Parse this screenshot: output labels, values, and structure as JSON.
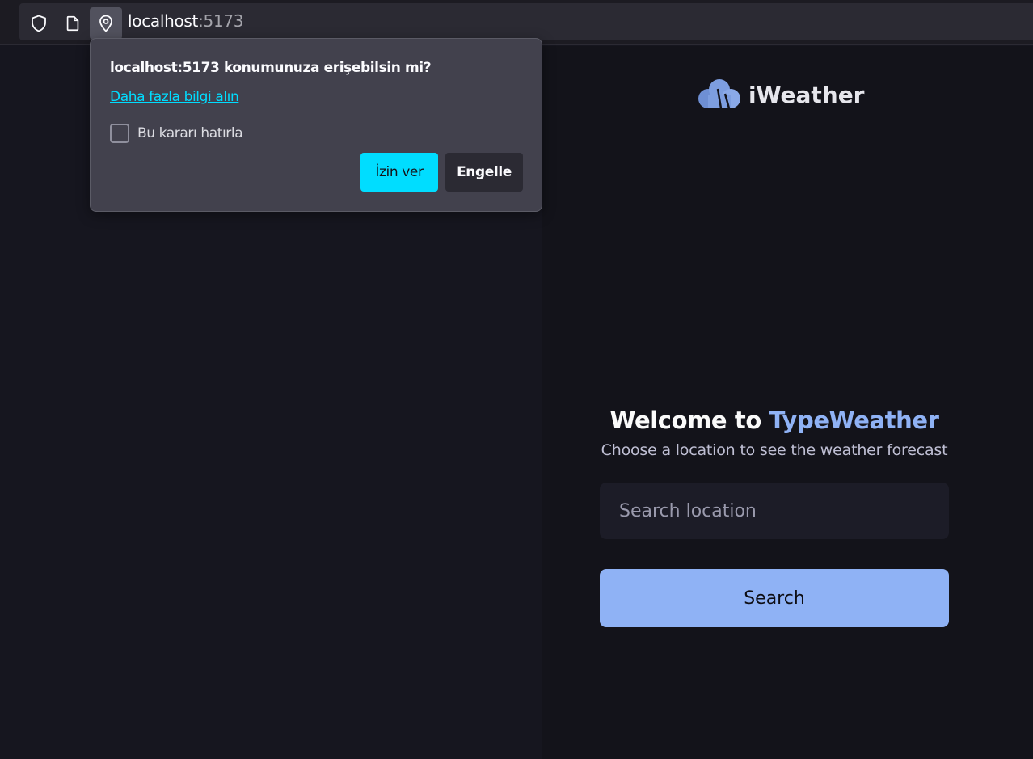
{
  "browser": {
    "url_host": "localhost",
    "url_port": ":5173",
    "icons": [
      "shield-icon",
      "page-icon",
      "location-pin-icon"
    ]
  },
  "permission_popup": {
    "title": "localhost:5173 konumunuza erişebilsin mi?",
    "learn_more_link": "Daha fazla bilgi alın",
    "remember_label": "Bu kararı hatırla",
    "remember_checked": false,
    "allow_label": "İzin ver",
    "block_label": "Engelle",
    "accent_color": "#00ddff"
  },
  "app": {
    "logo_text": "iWeather",
    "welcome_prefix": "Welcome to ",
    "welcome_brand": "TypeWeather",
    "subtitle": "Choose a location to see the weather forecast",
    "search_placeholder": "Search location",
    "search_button_label": "Search",
    "accent_color": "#8fb2f5"
  }
}
